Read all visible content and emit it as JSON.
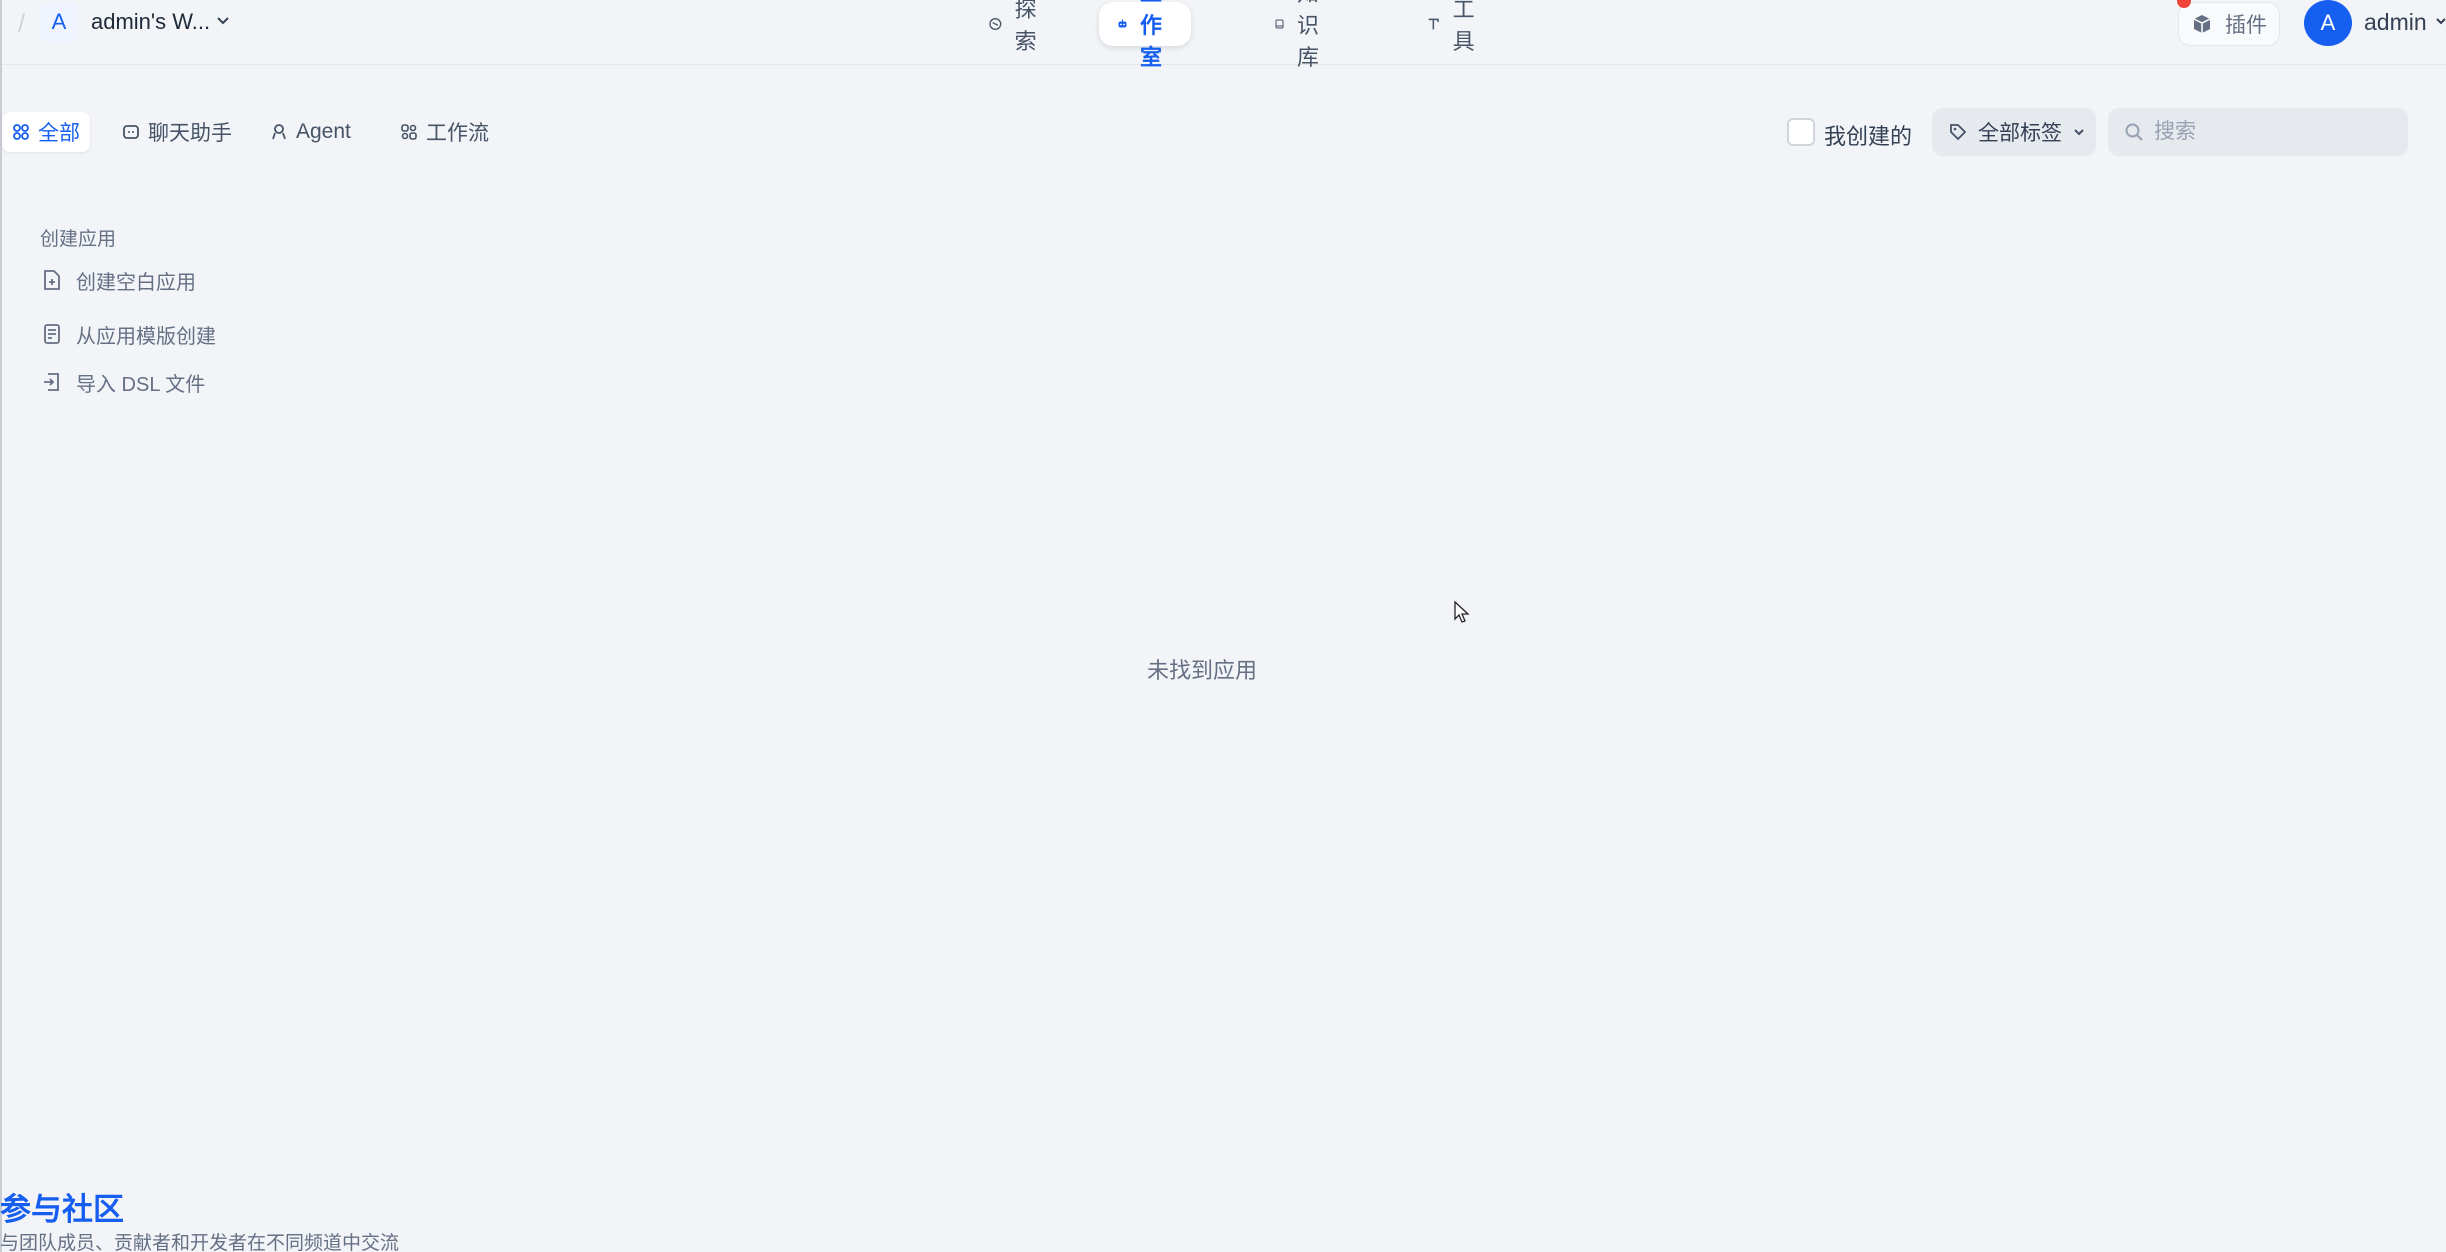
{
  "header": {
    "workspace": {
      "avatar_letter": "A",
      "name": "admin's W..."
    },
    "nav": [
      {
        "label": "探索",
        "icon": "compass-icon",
        "active": false
      },
      {
        "label": "工作室",
        "icon": "robot-icon",
        "active": true
      },
      {
        "label": "知识库",
        "icon": "book-icon",
        "active": false
      },
      {
        "label": "工具",
        "icon": "hammer-icon",
        "active": false
      }
    ],
    "plugin": {
      "label": "插件",
      "icon": "cube-icon"
    },
    "user": {
      "avatar_letter": "A",
      "name": "admin"
    }
  },
  "filters": {
    "tabs": [
      {
        "label": "全部",
        "icon": "grid-icon",
        "active": true
      },
      {
        "label": "聊天助手",
        "icon": "chat-icon",
        "active": false
      },
      {
        "label": "Agent",
        "icon": "agent-icon",
        "active": false
      },
      {
        "label": "工作流",
        "icon": "workflow-icon",
        "active": false
      }
    ],
    "created_by_me": {
      "label": "我创建的",
      "checked": false
    },
    "tags": {
      "label": "全部标签"
    },
    "search": {
      "placeholder": "搜索",
      "value": ""
    }
  },
  "create": {
    "title": "创建应用",
    "items": [
      {
        "label": "创建空白应用",
        "icon": "file-plus-icon"
      },
      {
        "label": "从应用模版创建",
        "icon": "template-icon"
      },
      {
        "label": "导入 DSL 文件",
        "icon": "import-icon"
      }
    ]
  },
  "empty_state": {
    "text": "未找到应用"
  },
  "community": {
    "title": "参与社区",
    "subtitle": "与团队成员、贡献者和开发者在不同频道中交流"
  },
  "colors": {
    "accent": "#155eef",
    "background": "#f2f4f7",
    "badge": "#f04438"
  }
}
